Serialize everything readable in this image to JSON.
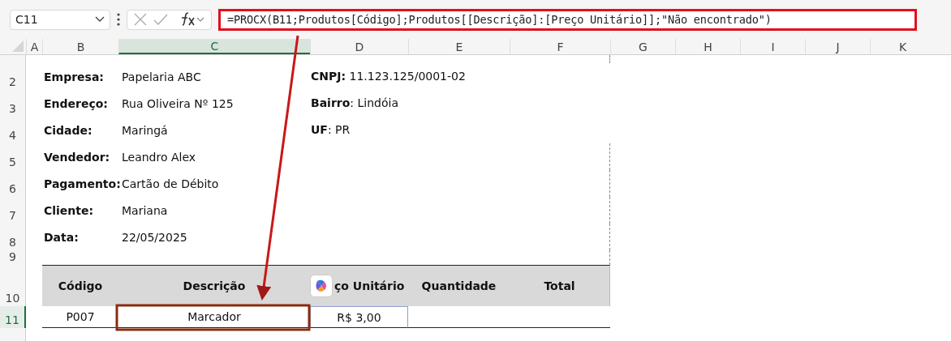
{
  "name_box": "C11",
  "formula": "=PROCX(B11;Produtos[Código];Produtos[[Descrição]:[Preço Unitário]];\"Não encontrado\")",
  "columns": [
    {
      "label": "A",
      "selected": false
    },
    {
      "label": "B",
      "selected": false
    },
    {
      "label": "C",
      "selected": true
    },
    {
      "label": "D",
      "selected": false
    },
    {
      "label": "E",
      "selected": false
    },
    {
      "label": "F",
      "selected": false
    },
    {
      "label": "G",
      "selected": false
    },
    {
      "label": "H",
      "selected": false
    },
    {
      "label": "I",
      "selected": false
    },
    {
      "label": "J",
      "selected": false
    },
    {
      "label": "K",
      "selected": false
    }
  ],
  "row_numbers": [
    {
      "label": "2",
      "selected": false
    },
    {
      "label": "3",
      "selected": false
    },
    {
      "label": "4",
      "selected": false
    },
    {
      "label": "5",
      "selected": false
    },
    {
      "label": "6",
      "selected": false
    },
    {
      "label": "7",
      "selected": false
    },
    {
      "label": "8",
      "selected": false
    },
    {
      "label": "9",
      "selected": false
    },
    {
      "label": "10",
      "selected": false
    },
    {
      "label": "11",
      "selected": true
    }
  ],
  "info_left": [
    {
      "label": "Empresa:",
      "value": "Papelaria ABC"
    },
    {
      "label": "Endereço:",
      "value": "Rua Oliveira Nº 125"
    },
    {
      "label": "Cidade:",
      "value": "Maringá"
    },
    {
      "label": "Vendedor:",
      "value": "Leandro Alex"
    },
    {
      "label": "Pagamento:",
      "value": "Cartão de Débito"
    },
    {
      "label": "Cliente:",
      "value": "Mariana"
    },
    {
      "label": "Data:",
      "value": "22/05/2025"
    }
  ],
  "info_right": [
    "**CNPJ:** 11.123.125/0001-02",
    "**Bairro**: Lindóia",
    "**UF**: PR"
  ],
  "table": {
    "columns": [
      "Código",
      "Descrição",
      "ço Unitário",
      "Quantidade",
      "Total"
    ],
    "rows": [
      {
        "cells": [
          "P007",
          "Marcador",
          "R$ 3,00"
        ]
      }
    ]
  }
}
